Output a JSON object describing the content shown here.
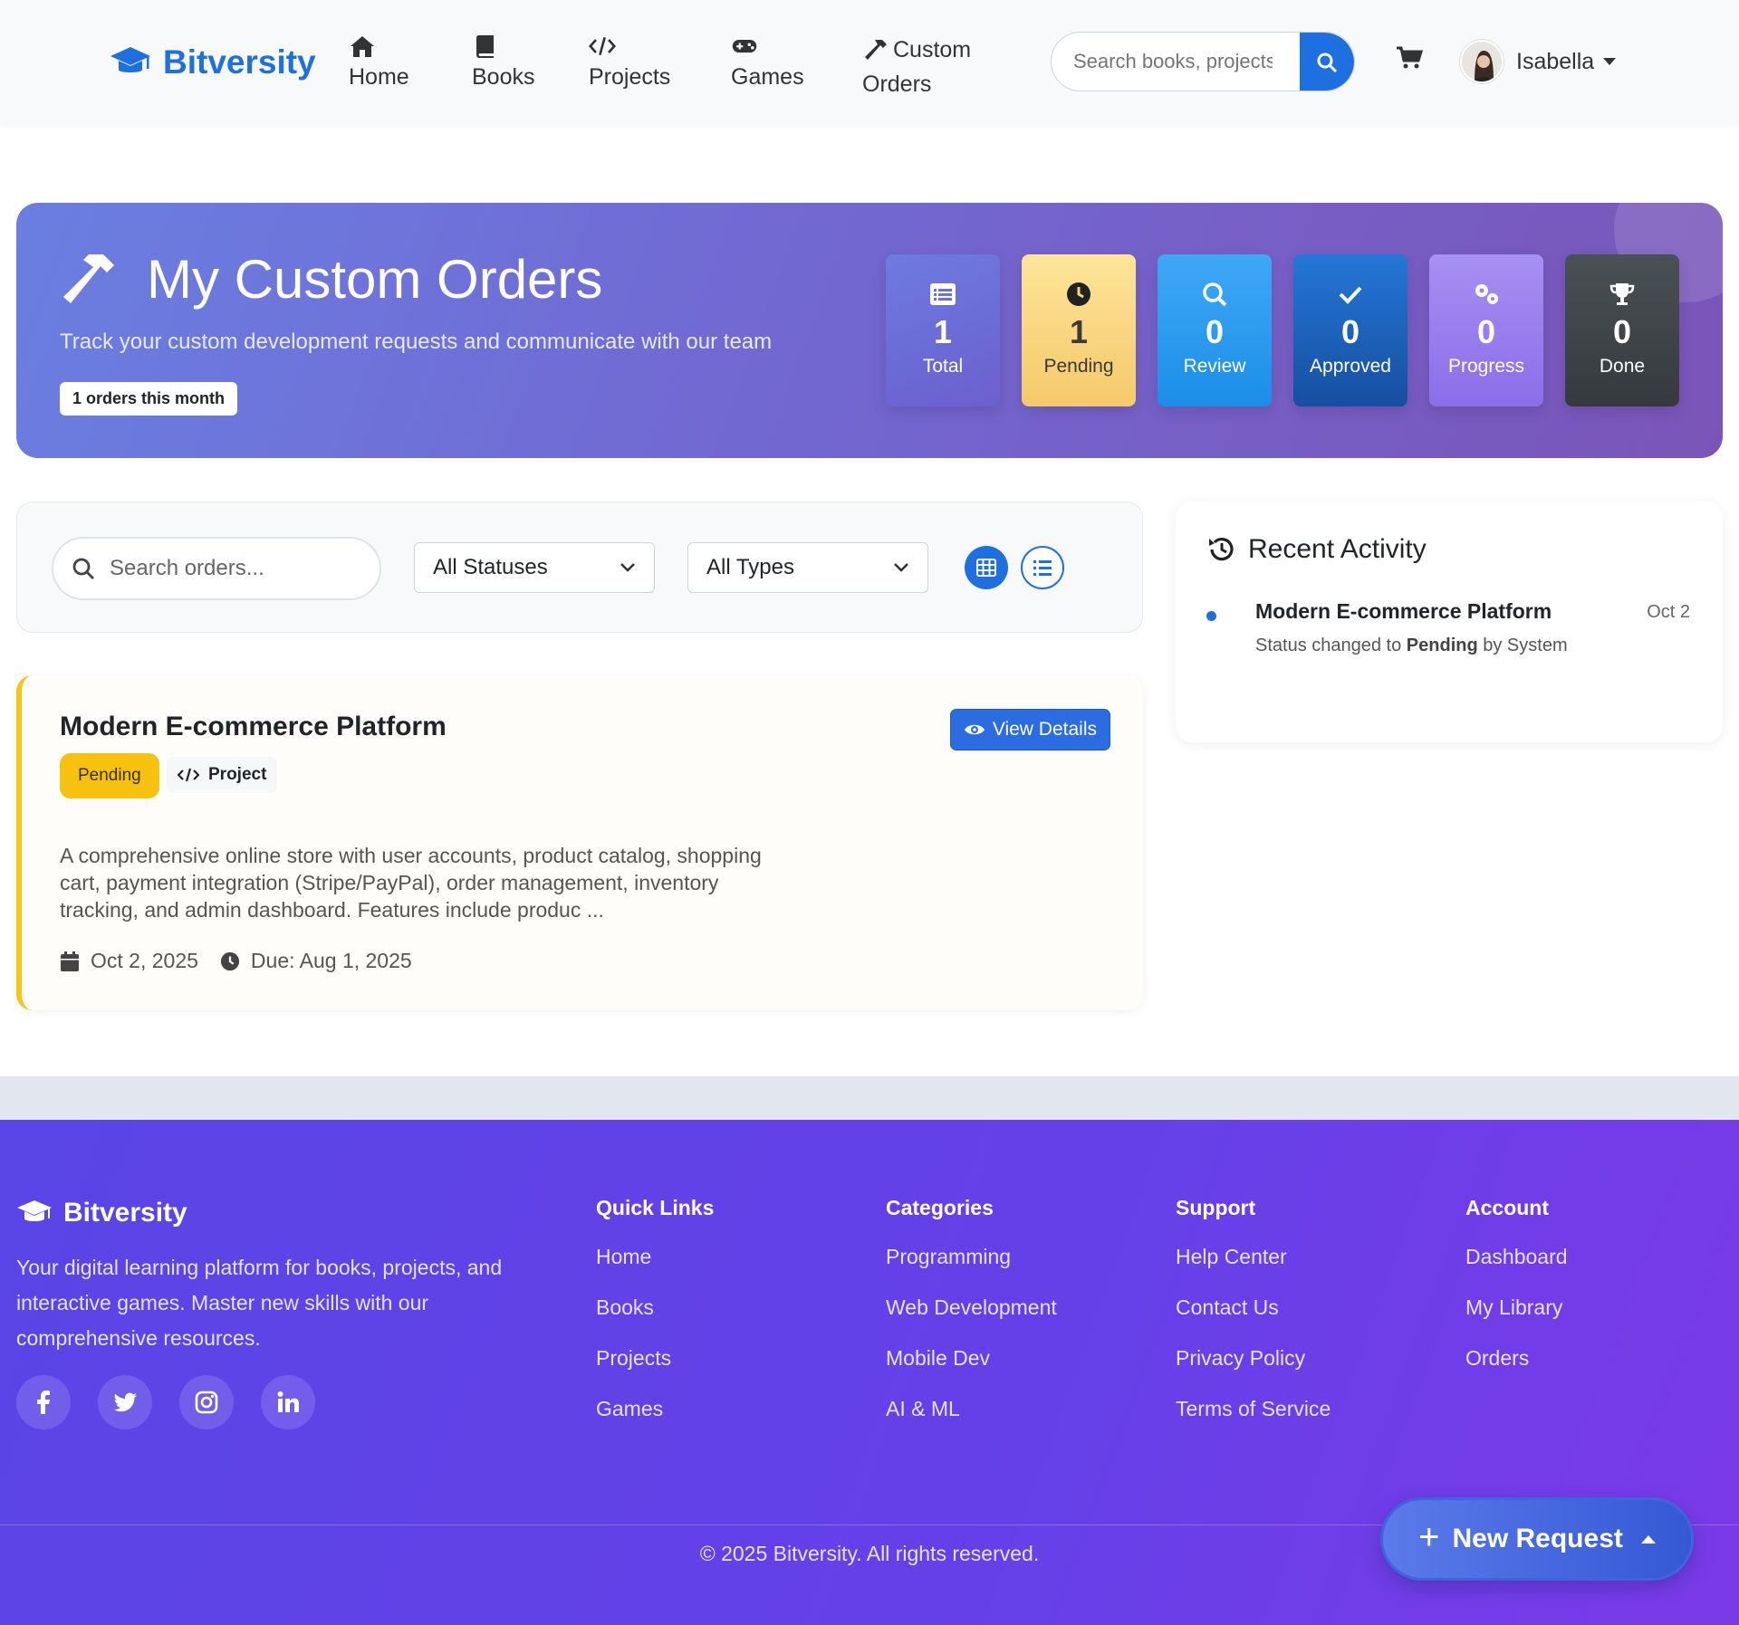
{
  "nav": {
    "brand": "Bitversity",
    "items": [
      {
        "label": "Home",
        "icon": "home-icon"
      },
      {
        "label": "Books",
        "icon": "book-icon"
      },
      {
        "label": "Projects",
        "icon": "code-icon"
      },
      {
        "label": "Games",
        "icon": "gamepad-icon"
      }
    ],
    "custom_orders": {
      "line1": "Custom",
      "line2": "Orders",
      "icon": "hammer-icon"
    },
    "search_placeholder": "Search books, projects",
    "user_name": "Isabella"
  },
  "hero": {
    "title": "My Custom Orders",
    "subtitle": "Track your custom development requests and communicate with our team",
    "badge": "1 orders this month",
    "stats": [
      {
        "value": "1",
        "label": "Total",
        "icon": "list-icon",
        "color": "#6d6fd8"
      },
      {
        "value": "1",
        "label": "Pending",
        "icon": "clock-icon",
        "color": "#f9d57a"
      },
      {
        "value": "0",
        "label": "Review",
        "icon": "search-icon",
        "color": "#2b9bf0"
      },
      {
        "value": "0",
        "label": "Approved",
        "icon": "check-icon",
        "color": "#1f63c2"
      },
      {
        "value": "0",
        "label": "Progress",
        "icon": "cogs-icon",
        "color": "#9a82f0"
      },
      {
        "value": "0",
        "label": "Done",
        "icon": "trophy-icon",
        "color": "#3f4548"
      }
    ]
  },
  "filters": {
    "search_placeholder": "Search orders...",
    "status_selected": "All Statuses",
    "type_selected": "All Types"
  },
  "order": {
    "title": "Modern E-commerce Platform",
    "status": "Pending",
    "type": "Project",
    "view_label": "View Details",
    "description": "A comprehensive online store with user accounts, product catalog, shopping cart, payment integration (Stripe/PayPal), order management, inventory tracking, and admin dashboard. Features include produc ...",
    "created": "Oct 2, 2025",
    "due": "Due: Aug 1, 2025"
  },
  "activity": {
    "title": "Recent Activity",
    "items": [
      {
        "name": "Modern E-commerce Platform",
        "date": "Oct 2",
        "desc_prefix": "Status changed to",
        "desc_status": "Pending",
        "desc_suffix": "by System"
      }
    ]
  },
  "footer": {
    "brand": "Bitversity",
    "about": "Your digital learning platform for books, projects, and interactive games. Master new skills with our comprehensive resources.",
    "columns": [
      {
        "title": "Quick Links",
        "links": [
          "Home",
          "Books",
          "Projects",
          "Games"
        ]
      },
      {
        "title": "Categories",
        "links": [
          "Programming",
          "Web Development",
          "Mobile Dev",
          "AI & ML"
        ]
      },
      {
        "title": "Support",
        "links": [
          "Help Center",
          "Contact Us",
          "Privacy Policy",
          "Terms of Service"
        ]
      },
      {
        "title": "Account",
        "links": [
          "Dashboard",
          "My Library",
          "Orders"
        ]
      }
    ],
    "copyright": "© 2025 Bitversity. All rights reserved."
  },
  "fab": {
    "label": "New Request"
  }
}
